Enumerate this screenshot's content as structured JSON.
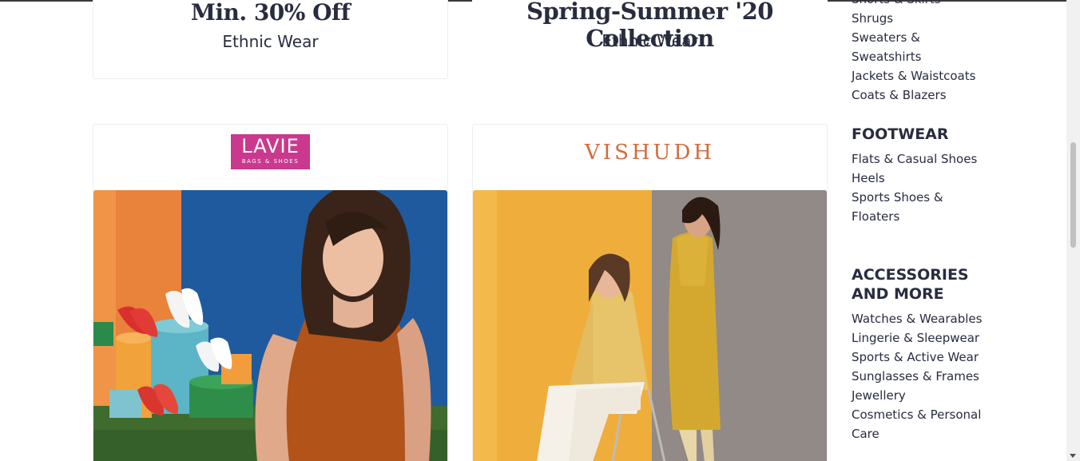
{
  "promos": [
    {
      "headline": "Min. 30% Off",
      "sub": "Ethnic Wear"
    },
    {
      "headline": "Spring-Summer '20 Collection",
      "sub": "Ethnic Wear"
    }
  ],
  "brands": [
    {
      "name": "LAVIE",
      "tagline": "BAGS & SHOES"
    },
    {
      "name": "VISHUDH"
    }
  ],
  "sidebar": {
    "sections": [
      {
        "items": [
          "Shorts & Skirts",
          "Shrugs",
          "Sweaters &",
          "Sweatshirts",
          "Jackets & Waistcoats",
          "Coats & Blazers"
        ]
      },
      {
        "heading": "FOOTWEAR",
        "items": [
          "Flats & Casual Shoes",
          "Heels",
          "Sports Shoes &",
          "Floaters"
        ]
      },
      {
        "heading_line1": "ACCESSORIES",
        "heading_line2": "AND MORE",
        "items": [
          "Watches & Wearables",
          "Lingerie & Sleepwear",
          "Sports & Active Wear",
          "Sunglasses & Frames",
          "Jewellery",
          "Cosmetics & Personal",
          "Care"
        ]
      }
    ]
  },
  "colors": {
    "lavie_brand": "#c93a8f",
    "vishudh_brand": "#d36b3c",
    "text": "#282c3f"
  }
}
